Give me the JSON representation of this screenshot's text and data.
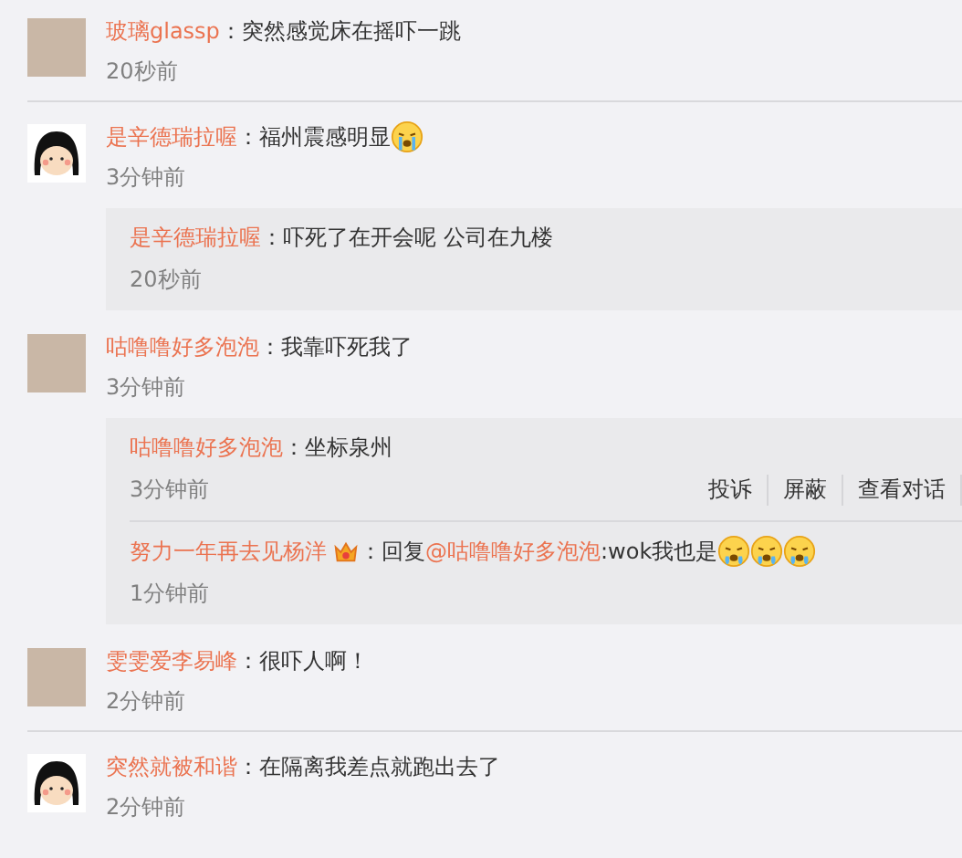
{
  "comments": [
    {
      "kind": "photo",
      "user": "玻璃glassp",
      "colon": "：",
      "text": "突然感觉床在摇吓一跳",
      "time": "20秒前",
      "divider": true
    },
    {
      "kind": "cartoon",
      "user": "是辛德瑞拉喔",
      "colon": "：",
      "text": "福州震感明显",
      "emojis": [
        {
          "kind": "crying"
        }
      ],
      "time": "3分钟前",
      "divider": false,
      "replies": [
        {
          "user": "是辛德瑞拉喔",
          "colon": "：",
          "text": "吓死了在开会呢 公司在九楼",
          "time": "20秒前",
          "badge": false
        }
      ]
    },
    {
      "kind": "photo",
      "user": "咕噜噜好多泡泡",
      "colon": "：",
      "text": "我靠吓死我了",
      "time": "3分钟前",
      "divider": false,
      "replies": [
        {
          "user": "咕噜噜好多泡泡",
          "colon": "：",
          "text": "坐标泉州",
          "time": "3分钟前",
          "badge": false,
          "actions": [
            "投诉",
            "屏蔽",
            "查看对话"
          ]
        },
        {
          "user": "努力一年再去见杨洋",
          "colon": "：",
          "prefix": "回复",
          "mention": "@咕噜噜好多泡泡",
          "text": ":wok我也是",
          "time": "1分钟前",
          "badge": true,
          "emojis": [
            {
              "kind": "tears"
            },
            {
              "kind": "tears"
            },
            {
              "kind": "tears"
            }
          ]
        }
      ]
    },
    {
      "kind": "photo",
      "user": "雯雯爱李易峰",
      "colon": "：",
      "text": "很吓人啊！",
      "time": "2分钟前",
      "divider": true
    },
    {
      "kind": "cartoon",
      "user": "突然就被和谐",
      "colon": "：",
      "text": "在隔离我差点就跑出去了",
      "time": "2分钟前",
      "divider": false
    }
  ]
}
